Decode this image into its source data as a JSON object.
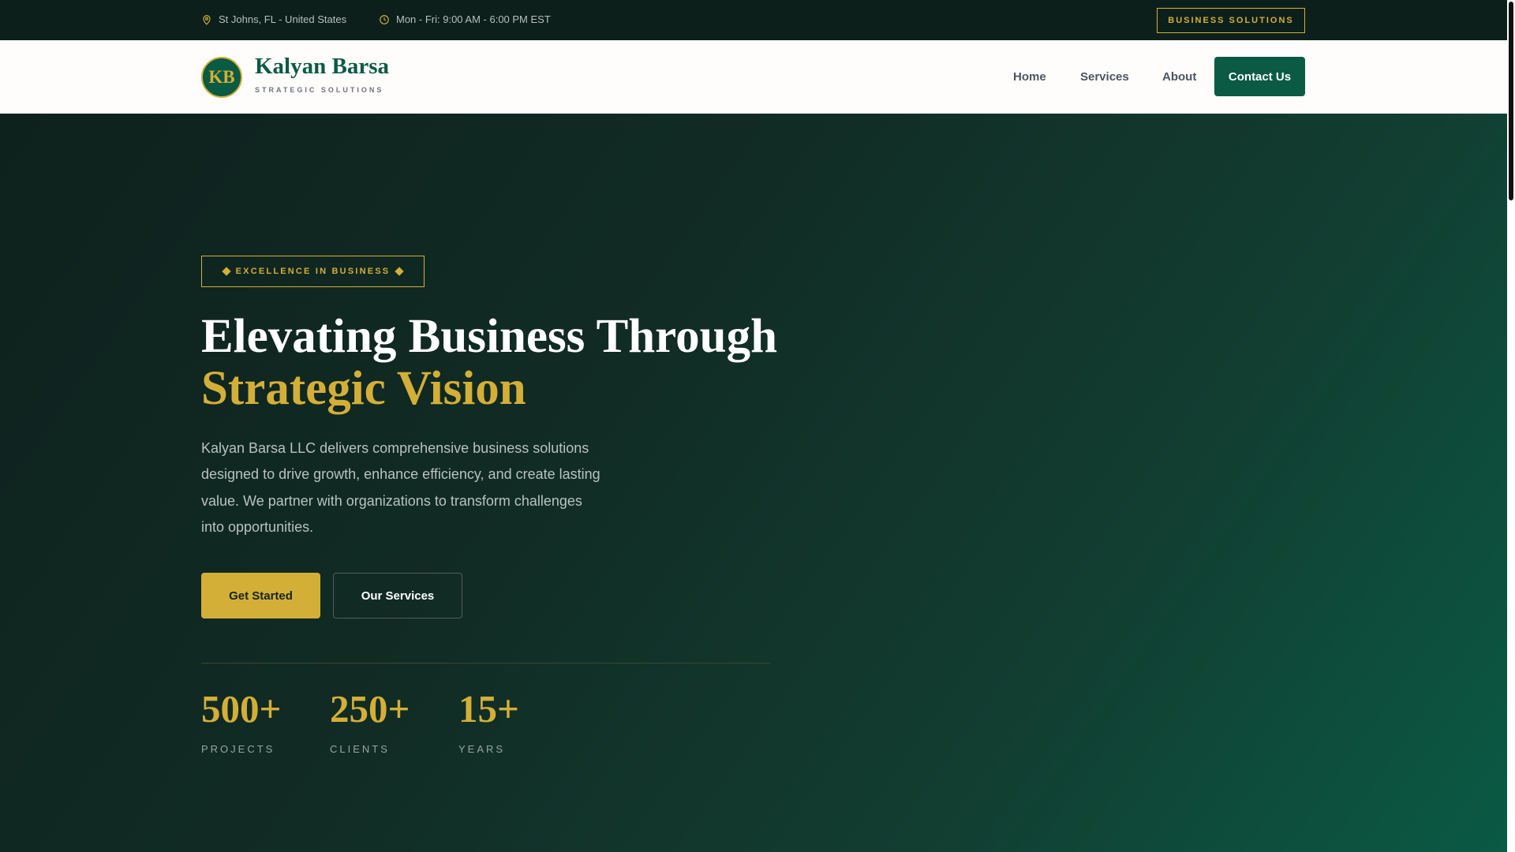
{
  "topbar": {
    "location": "St Johns, FL - United States",
    "hours": "Mon - Fri: 9:00 AM - 6:00 PM EST",
    "business_button": "BUSINESS SOLUTIONS"
  },
  "nav": {
    "logo_initials": "KB",
    "brand": "Kalyan Barsa",
    "tagline": "STRATEGIC SOLUTIONS",
    "links": [
      "Home",
      "Services",
      "About"
    ],
    "contact": "Contact Us"
  },
  "hero": {
    "badge": "EXCELLENCE IN BUSINESS",
    "title_line1": "Elevating Business Through",
    "title_line2": "Strategic Vision",
    "paragraph": "Kalyan Barsa LLC delivers comprehensive business solutions designed to drive growth, enhance efficiency, and create lasting value. We partner with organizations to transform challenges into opportunities.",
    "primary_button": "Get Started",
    "secondary_button": "Our Services",
    "stats": [
      {
        "value": "500+",
        "label": "PROJECTS"
      },
      {
        "value": "250+",
        "label": "CLIENTS"
      },
      {
        "value": "15+",
        "label": "YEARS"
      }
    ]
  },
  "colors": {
    "accent": "#d4af37",
    "brand": "#0a5a44",
    "dark": "#0c1f1b"
  }
}
